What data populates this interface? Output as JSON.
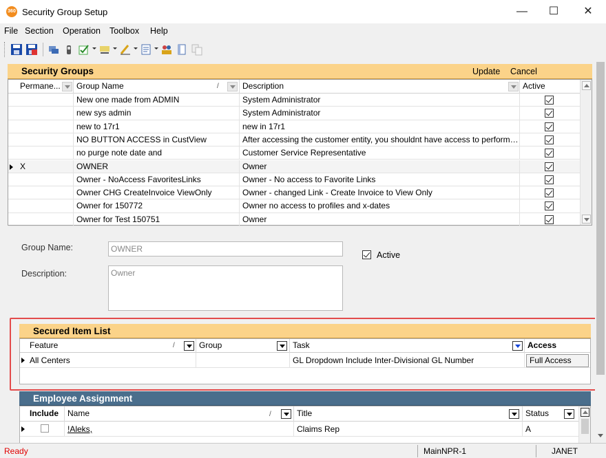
{
  "window": {
    "title": "Security Group Setup",
    "app_badge": "360",
    "minimize": "—",
    "maximize": "☐",
    "close": "✕"
  },
  "menu": [
    "File",
    "Section",
    "Operation",
    "Toolbox",
    "Help"
  ],
  "toolbar": {
    "icons": [
      "save-icon",
      "save-all-icon",
      "refresh-icon",
      "security-icon",
      "check-icon",
      "highlight-icon",
      "pen-icon",
      "document-icon",
      "users-icon",
      "page-icon",
      "copy-icon"
    ]
  },
  "security_groups": {
    "title": "Security Groups",
    "update_label": "Update",
    "cancel_label": "Cancel",
    "columns": {
      "permanent": "Permane...",
      "group_name": "Group Name",
      "description": "Description",
      "active": "Active"
    },
    "rows": [
      {
        "permanent": "",
        "group_name": "New one made from ADMIN",
        "description": "System Administrator",
        "active": true,
        "selected": false
      },
      {
        "permanent": "",
        "group_name": "new sys admin",
        "description": "System Administrator",
        "active": true,
        "selected": false
      },
      {
        "permanent": "",
        "group_name": "new to 17r1",
        "description": "new in 17r1",
        "active": true,
        "selected": false
      },
      {
        "permanent": "",
        "group_name": "NO BUTTON ACCESS in CustView",
        "description": "After accessing the customer entity, you shouldnt have access to perform a...",
        "active": true,
        "selected": false
      },
      {
        "permanent": "",
        "group_name": "no purge note date and",
        "description": "Customer Service Representative",
        "active": true,
        "selected": false
      },
      {
        "permanent": "X",
        "group_name": "OWNER",
        "description": "Owner",
        "active": true,
        "selected": true
      },
      {
        "permanent": "",
        "group_name": "Owner - NoAccess  FavoritesLinks",
        "description": "Owner - No access to Favorite Links",
        "active": true,
        "selected": false
      },
      {
        "permanent": "",
        "group_name": "Owner CHG CreateInvoice ViewOnly",
        "description": "Owner - changed Link - Create Invoice to View Only",
        "active": true,
        "selected": false
      },
      {
        "permanent": "",
        "group_name": "Owner for 150772",
        "description": "Owner no access to profiles and x-dates",
        "active": true,
        "selected": false
      },
      {
        "permanent": "",
        "group_name": "Owner for Test 150751",
        "description": "Owner",
        "active": true,
        "selected": false
      }
    ]
  },
  "detail_form": {
    "group_name_label": "Group Name:",
    "group_name_value": "OWNER",
    "description_label": "Description:",
    "description_value": "Owner",
    "active_label": "Active",
    "active_checked": true
  },
  "secured_items": {
    "title": "Secured Item List",
    "columns": {
      "feature": "Feature",
      "group": "Group",
      "task": "Task",
      "access": "Access"
    },
    "rows": [
      {
        "feature": "All Centers",
        "group": "",
        "task": "GL Dropdown Include Inter-Divisional GL Number",
        "access": "Full Access"
      }
    ]
  },
  "employee_assignment": {
    "title": "Employee Assignment",
    "columns": {
      "include": "Include",
      "name": "Name",
      "title": "Title",
      "status": "Status"
    },
    "rows": [
      {
        "include": false,
        "name": "!Aleks,",
        "title": "Claims Rep",
        "status": "A"
      }
    ]
  },
  "status_bar": {
    "status": "Ready",
    "server": "MainNPR-1",
    "user": "JANET"
  },
  "colors": {
    "panel_header_orange": "#fbd389",
    "panel_header_blue": "#4a6e8c",
    "highlight_red": "#e34b4b",
    "ready_red": "#e00000"
  }
}
